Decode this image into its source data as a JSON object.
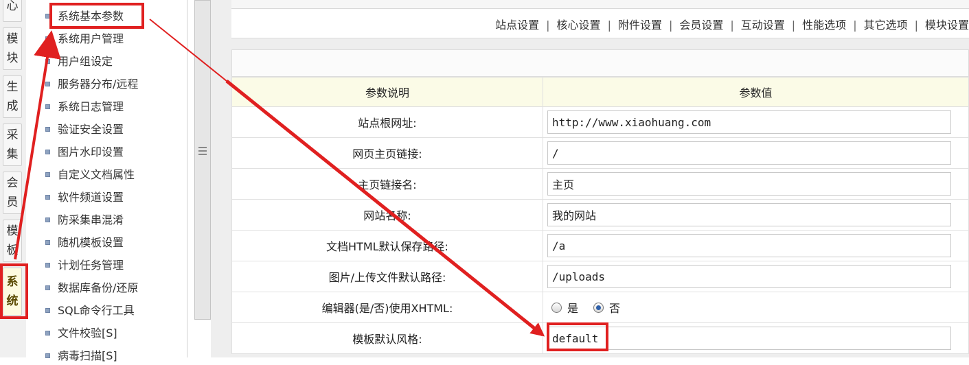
{
  "sidebar_tabs": [
    {
      "chars": [
        "心"
      ]
    },
    {
      "chars": [
        "模",
        "块"
      ]
    },
    {
      "chars": [
        "生",
        "成"
      ]
    },
    {
      "chars": [
        "采",
        "集"
      ]
    },
    {
      "chars": [
        "会",
        "员"
      ]
    },
    {
      "chars": [
        "模",
        "板"
      ]
    },
    {
      "chars": [
        "系",
        "统"
      ],
      "active": true
    }
  ],
  "menu_items": [
    "系统基本参数",
    "系统用户管理",
    "用户组设定",
    "服务器分布/远程",
    "系统日志管理",
    "验证安全设置",
    "图片水印设置",
    "自定义文档属性",
    "软件频道设置",
    "防采集串混淆",
    "随机模板设置",
    "计划任务管理",
    "数据库备份/还原",
    "SQL命令行工具",
    "文件校验[S]",
    "病毒扫描[S]"
  ],
  "settings_nav": [
    "站点设置",
    "核心设置",
    "附件设置",
    "会员设置",
    "互动设置",
    "性能选项",
    "其它选项",
    "模块设置"
  ],
  "settings_nav_separator": "|",
  "table": {
    "headers": {
      "desc": "参数说明",
      "value": "参数值"
    },
    "rows": [
      {
        "label": "站点根网址:",
        "value": "http://www.xiaohuang.com"
      },
      {
        "label": "网页主页链接:",
        "value": "/"
      },
      {
        "label": "主页链接名:",
        "value": "主页"
      },
      {
        "label": "网站名称:",
        "value": "我的网站"
      },
      {
        "label": "文档HTML默认保存路径:",
        "value": "/a"
      },
      {
        "label": "图片/上传文件默认路径:",
        "value": "/uploads"
      }
    ],
    "xhtml_row": {
      "label": "编辑器(是/否)使用XHTML:",
      "yes": "是",
      "no": "否",
      "selected": "否"
    },
    "style_row": {
      "label": "模板默认风格:",
      "value": "default"
    }
  },
  "colors": {
    "annotation": "#e02020",
    "header_bg": "#fbfbe7"
  }
}
